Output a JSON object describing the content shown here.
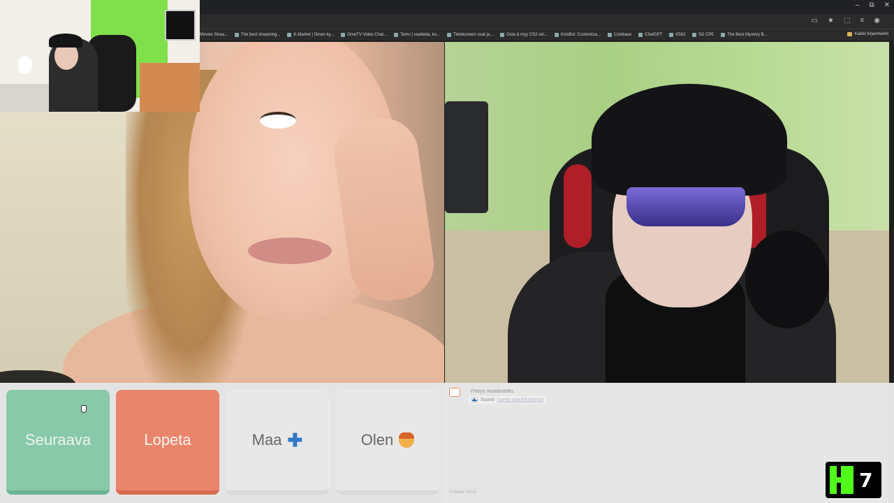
{
  "browser": {
    "bookmarks": [
      "Movies Strea...",
      "The best streaming...",
      "K-Market | Oman ky...",
      "OmeTV Video Chat...",
      "Temu | vaatteita, ko...",
      "Tietokoneen osat ja...",
      "Osta & myy CS2-ski...",
      "KickBot: Customiza...",
      "Coinbase",
      "ChatGPT",
      "K562",
      "5G CPE",
      "The Best Mystery B..."
    ],
    "bookmarks_other": "Kaikki kirjanmerkit",
    "window_controls": [
      "–",
      "⧉",
      "✕"
    ]
  },
  "buttons": {
    "next": "Seuraava",
    "stop": "Lopeta",
    "country": "Maa",
    "gender": "Olen"
  },
  "chat": {
    "system_msg": "Yhteys muodostettu.",
    "country_label": "Suomi",
    "country_link": "lopeta vaarinkaytosta",
    "input_placeholder": "Kirjoita viesti"
  },
  "overlay": {
    "kick_number": "7"
  },
  "colors": {
    "next": "#87c9a8",
    "stop": "#e9856a",
    "neutral": "#e8e8e8",
    "kick_green": "#53fc18"
  }
}
